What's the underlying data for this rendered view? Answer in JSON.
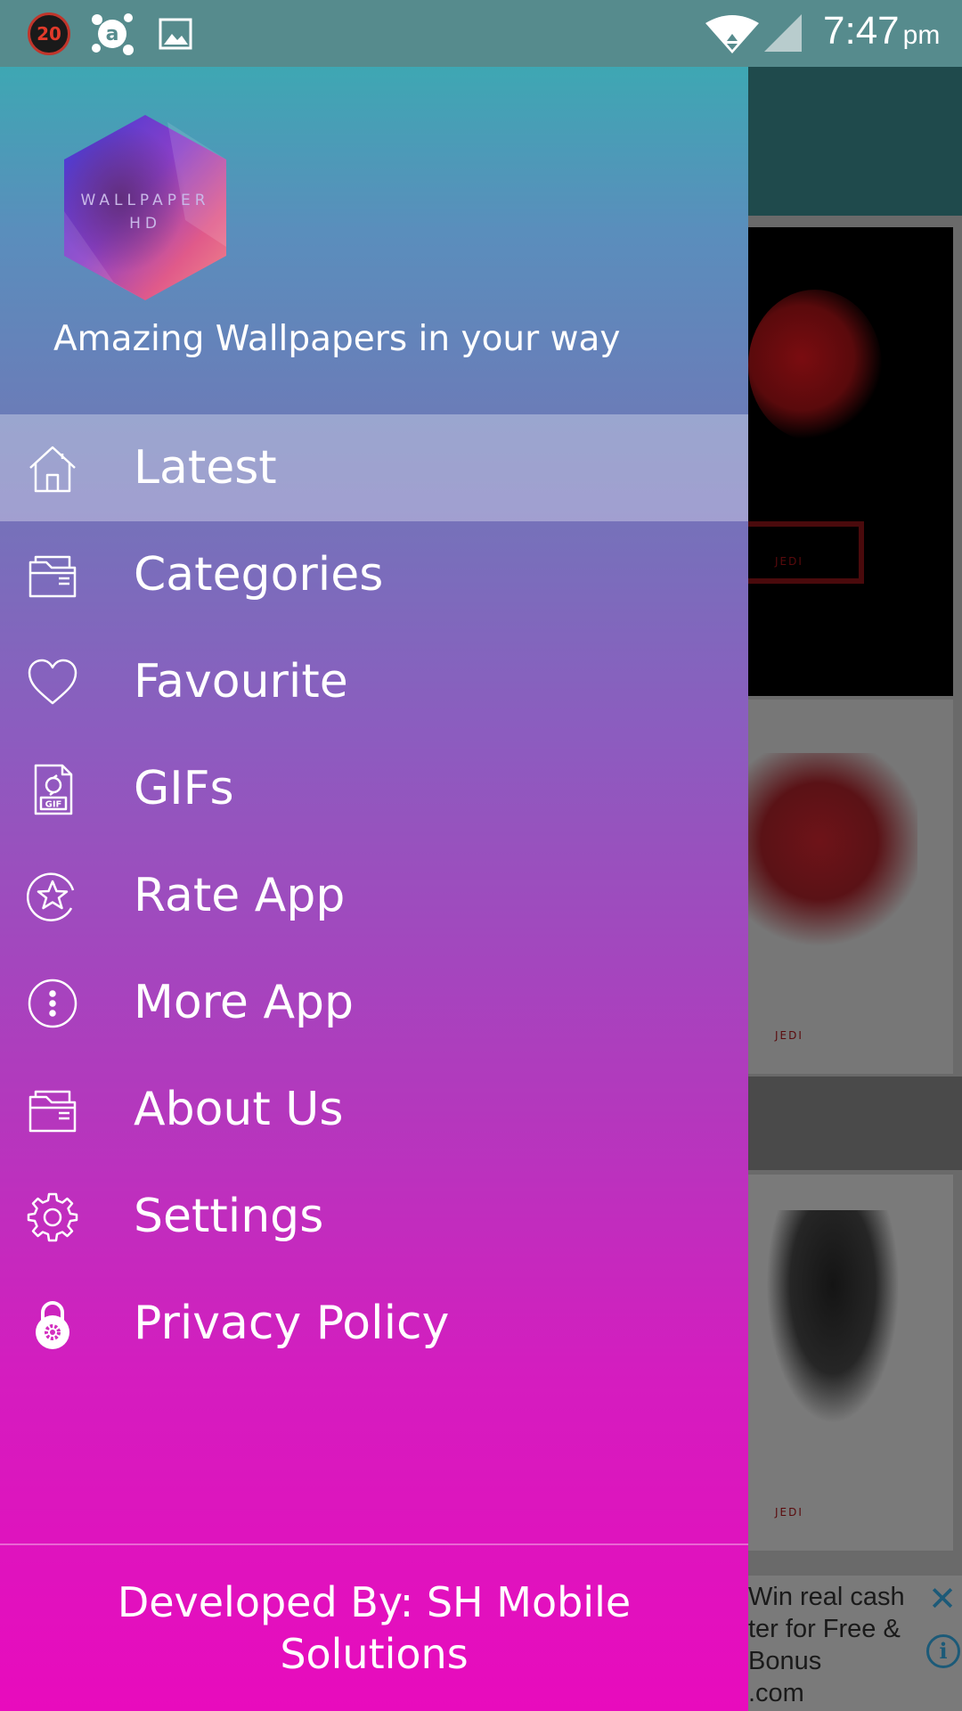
{
  "status_bar": {
    "notification_count": "20",
    "time": "7:47",
    "ampm": "pm",
    "icons": [
      "count-badge",
      "avast-icon",
      "image-icon",
      "wifi-icon",
      "signal-icon"
    ]
  },
  "drawer": {
    "logo": {
      "line1": "WALLPAPER",
      "line2": "HD"
    },
    "tagline": "Amazing Wallpapers in your way",
    "menu": [
      {
        "label": "Latest",
        "icon": "home-icon",
        "active": true
      },
      {
        "label": "Categories",
        "icon": "folder-icon",
        "active": false
      },
      {
        "label": "Favourite",
        "icon": "heart-icon",
        "active": false
      },
      {
        "label": "GIFs",
        "icon": "gif-file-icon",
        "active": false
      },
      {
        "label": "Rate App",
        "icon": "star-circle-icon",
        "active": false
      },
      {
        "label": "More App",
        "icon": "more-circle-icon",
        "active": false
      },
      {
        "label": "About Us",
        "icon": "folder-icon",
        "active": false
      },
      {
        "label": "Settings",
        "icon": "gear-icon",
        "active": false
      },
      {
        "label": "Privacy Policy",
        "icon": "lock-icon",
        "active": false
      }
    ],
    "footer": "Developed By: SH Mobile Solutions"
  },
  "background": {
    "ad_text": "Win real cash\nter for Free &\nBonus\n.com",
    "card_caption": "JEDI"
  },
  "colors": {
    "status_bar": "#568b8d",
    "drawer_top": "#3ea7b3",
    "drawer_bottom": "#e80bbd"
  }
}
